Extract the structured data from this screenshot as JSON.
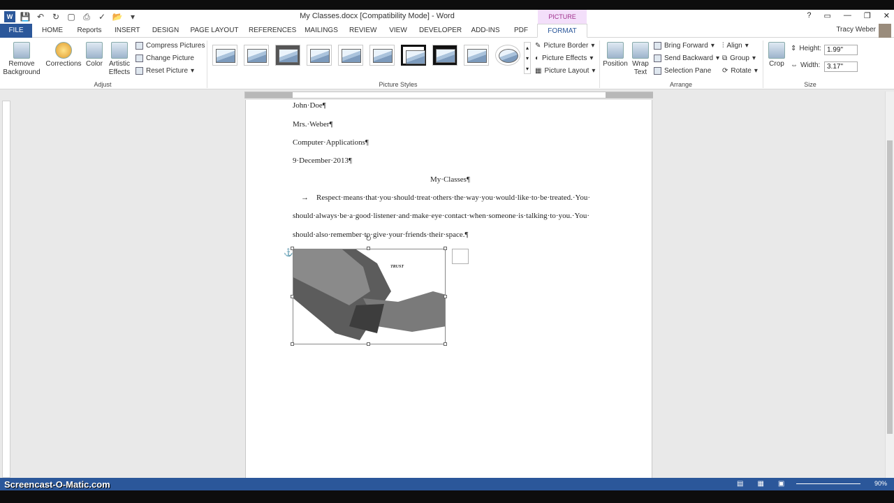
{
  "title_bar": {
    "document_title": "My Classes.docx [Compatibility Mode] - Word",
    "context_tab_group": "PICTURE TOOLS",
    "help": "?"
  },
  "tabs": [
    "FILE",
    "HOME",
    "Reports",
    "INSERT",
    "DESIGN",
    "PAGE LAYOUT",
    "REFERENCES",
    "MAILINGS",
    "REVIEW",
    "VIEW",
    "DEVELOPER",
    "ADD-INS",
    "PDF",
    "FORMAT"
  ],
  "user": {
    "name": "Tracy Weber"
  },
  "ribbon": {
    "adjust": {
      "label": "Adjust",
      "remove_background": "Remove Background",
      "corrections": "Corrections",
      "color": "Color",
      "artistic_effects": "Artistic Effects",
      "compress": "Compress Pictures",
      "change": "Change Picture",
      "reset": "Reset Picture"
    },
    "picture_styles": {
      "label": "Picture Styles",
      "border": "Picture Border",
      "effects": "Picture Effects",
      "layout": "Picture Layout"
    },
    "arrange": {
      "label": "Arrange",
      "position": "Position",
      "wrap_text": "Wrap Text",
      "bring_forward": "Bring Forward",
      "send_backward": "Send Backward",
      "selection_pane": "Selection Pane",
      "align": "Align",
      "group": "Group",
      "rotate": "Rotate"
    },
    "size": {
      "label": "Size",
      "crop": "Crop",
      "height_label": "Height:",
      "height": "1.99\"",
      "width_label": "Width:",
      "width": "3.17\""
    }
  },
  "document": {
    "lines": [
      "John·Doe¶",
      "Mrs.·Weber¶",
      "Computer·Applications¶",
      "9·December·2013¶"
    ],
    "heading": "My·Classes¶",
    "tab_arrow": "→",
    "para_line1": "Respect·means·that·you·should·treat·others·the·way·you·would·like·to·be·treated.·You·",
    "para_line2": "should·always·be·a·good·listener·and·make·eye·contact·when·someone·is·talking·to·you.·You·",
    "para_line3": "should·also·remember·to·give·your·friends·their·space.¶",
    "image_caption": "TRUST",
    "anchor": "⚓"
  },
  "status": {
    "zoom": "90%"
  },
  "watermark": "Screencast-O-Matic.com"
}
